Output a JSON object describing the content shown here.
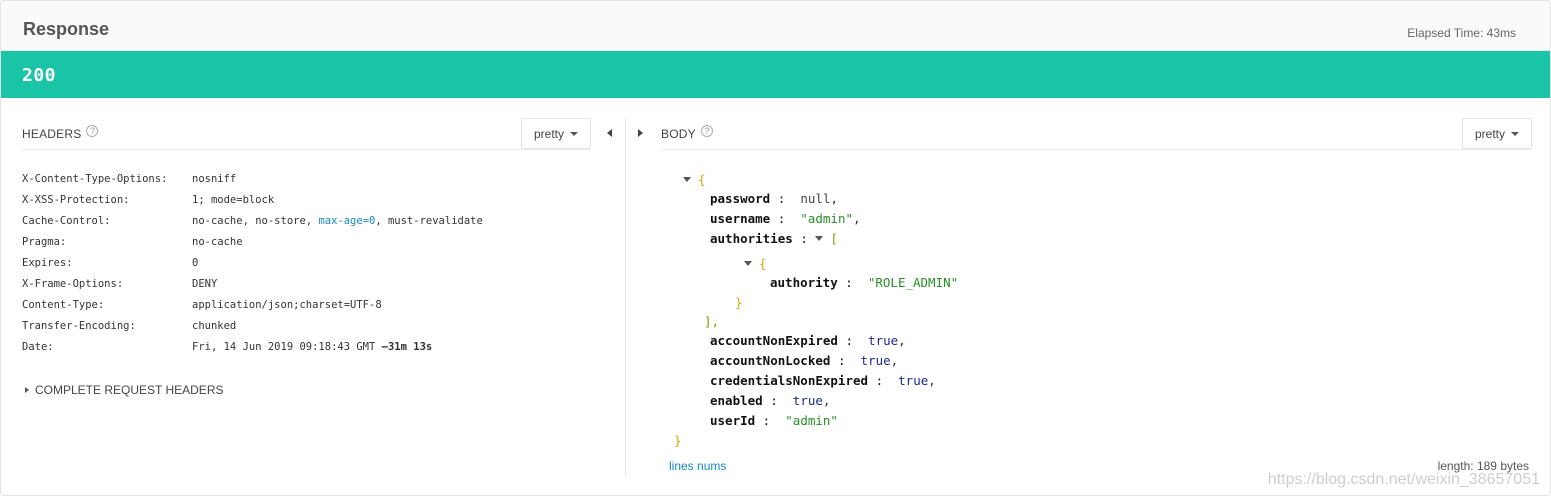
{
  "response": {
    "title": "Response",
    "elapsed": "Elapsed Time: 43ms",
    "status_code": "200"
  },
  "headers_panel": {
    "label": "HEADERS",
    "format_button": "pretty",
    "rows": [
      {
        "name": "X-Content-Type-Options:",
        "value": "nosniff"
      },
      {
        "name": "X-XSS-Protection:",
        "value": "1; mode=block"
      },
      {
        "name": "Cache-Control:",
        "value_before": "no-cache, no-store, ",
        "value_highlight": "max-age=0",
        "value_after": ", must-revalidate"
      },
      {
        "name": "Pragma:",
        "value": "no-cache"
      },
      {
        "name": "Expires:",
        "value": "0"
      },
      {
        "name": "X-Frame-Options:",
        "value": "DENY"
      },
      {
        "name": "Content-Type:",
        "value": "application/json;charset=UTF-8"
      },
      {
        "name": "Transfer-Encoding:",
        "value": "chunked"
      },
      {
        "name": "Date:",
        "value": "Fri, 14 Jun 2019 09:18:43 GMT ",
        "value_bold": "—31m 13s"
      }
    ],
    "complete_request_headers": "COMPLETE REQUEST HEADERS"
  },
  "body_panel": {
    "label": "BODY",
    "format_button": "pretty",
    "json": {
      "open_brace": "{",
      "close_brace": "}",
      "password_key": "password",
      "password_val": "null",
      "username_key": "username",
      "username_val": "\"admin\"",
      "authorities_key": "authorities",
      "open_bracket": "[",
      "close_bracket": "],",
      "inner_open": "{",
      "inner_close": "}",
      "authority_key": "authority",
      "authority_val": "\"ROLE_ADMIN\"",
      "accountNonExpired_key": "accountNonExpired",
      "accountNonExpired_val": "true",
      "accountNonLocked_key": "accountNonLocked",
      "accountNonLocked_val": "true",
      "credentialsNonExpired_key": "credentialsNonExpired",
      "credentialsNonExpired_val": "true",
      "enabled_key": "enabled",
      "enabled_val": "true",
      "userId_key": "userId",
      "userId_val": "\"admin\""
    },
    "lines_nums": "lines nums",
    "length": "length: 189 bytes"
  },
  "watermark": "https://blog.csdn.net/weixin_38657051",
  "colors": {
    "status_bar": "#1ac5a7",
    "link": "#1a87c4",
    "string": "#2a8f2a",
    "boolean": "#1c2a8c",
    "brace": "#d9a400"
  }
}
